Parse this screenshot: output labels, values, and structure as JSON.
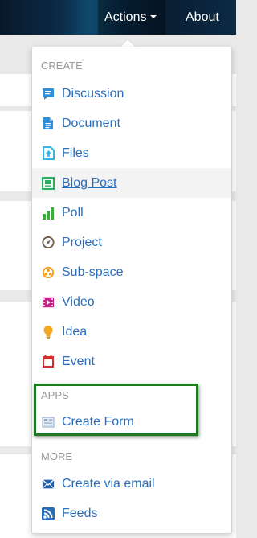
{
  "nav": {
    "actions_label": "Actions",
    "about_label": "About"
  },
  "menu": {
    "create_heading": "CREATE",
    "apps_heading": "APPS",
    "more_heading": "MORE",
    "create_items": [
      {
        "label": "Discussion",
        "icon": "discussion-icon",
        "color": "#2f8fd8"
      },
      {
        "label": "Document",
        "icon": "document-icon",
        "color": "#2f8fd8"
      },
      {
        "label": "Files",
        "icon": "files-upload-icon",
        "color": "#33b5e5"
      },
      {
        "label": "Blog Post",
        "icon": "blog-post-icon",
        "color": "#27ae60"
      },
      {
        "label": "Poll",
        "icon": "poll-icon",
        "color": "#3bab3b"
      },
      {
        "label": "Project",
        "icon": "project-icon",
        "color": "#6b5b4b"
      },
      {
        "label": "Sub-space",
        "icon": "sub-space-icon",
        "color": "#f39c12"
      },
      {
        "label": "Video",
        "icon": "video-icon",
        "color": "#d0208c"
      },
      {
        "label": "Idea",
        "icon": "idea-icon",
        "color": "#f5a623"
      },
      {
        "label": "Event",
        "icon": "event-icon",
        "color": "#d32f2f"
      }
    ],
    "apps_items": [
      {
        "label": "Create Form",
        "icon": "form-icon",
        "color": "#8fa8c8"
      }
    ],
    "more_items": [
      {
        "label": "Create via email",
        "icon": "email-icon",
        "color": "#1f5fa8"
      },
      {
        "label": "Feeds",
        "icon": "feeds-icon",
        "color": "#2a6ebb"
      }
    ],
    "hover_item": "Blog Post",
    "highlight_color": "#1e7a1e"
  }
}
